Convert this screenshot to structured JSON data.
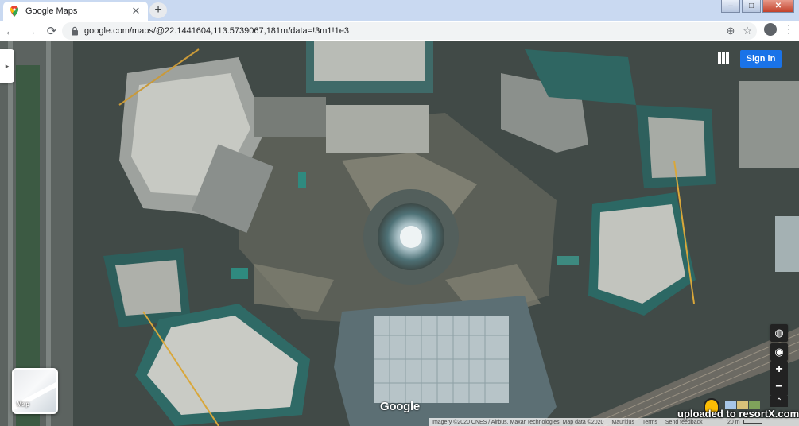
{
  "window": {
    "controls": {
      "minimize": "–",
      "maximize": "□",
      "close": "✕"
    }
  },
  "tab": {
    "title": "Google Maps",
    "close": "✕",
    "new_tab": "+"
  },
  "toolbar": {
    "back": "←",
    "forward": "→",
    "reload": "⟳",
    "url": "google.com/maps/@22.1441604,113.5739067,181m/data=!3m1!1e3",
    "add_icon": "⊕",
    "star_icon": "☆",
    "menu": "⋮"
  },
  "map": {
    "side_toggle": "▸",
    "sign_in": "Sign in",
    "globe": "◍",
    "locate": "◉",
    "zoom_in": "+",
    "zoom_out": "−",
    "expand": "⌃",
    "layer_label": "Map",
    "google_logo": "Google",
    "attribution": {
      "imagery": "Imagery ©2020 CNES / Airbus, Maxar Technologies, Map data ©2020",
      "country": "Mauritius",
      "terms": "Terms",
      "feedback": "Send feedback"
    },
    "scale": "20 m",
    "watermark": "uploaded to resortX.com"
  },
  "colors": {
    "accent": "#1a73e8",
    "tab_strip": "#c9d9f1"
  }
}
